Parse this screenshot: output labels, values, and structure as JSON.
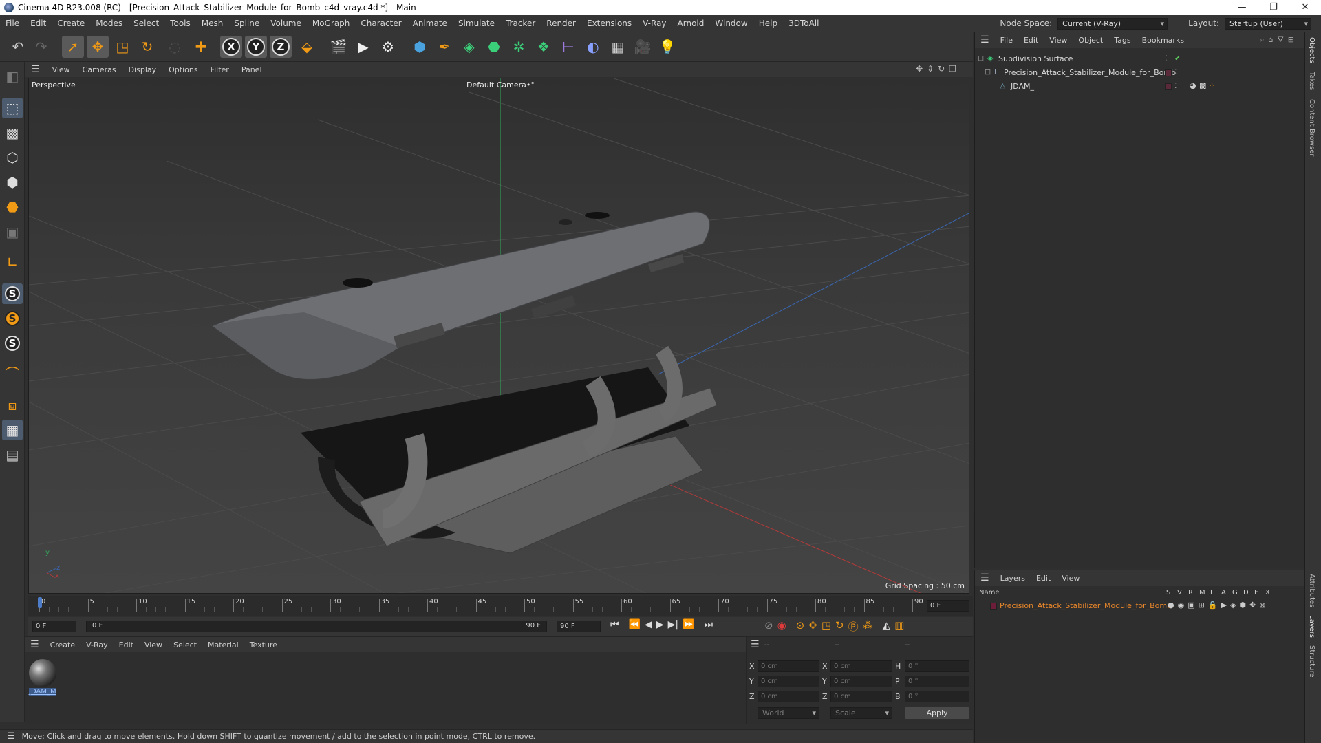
{
  "window": {
    "title": "Cinema 4D R23.008 (RC) - [Precision_Attack_Stabilizer_Module_for_Bomb_c4d_vray.c4d *] - Main",
    "controls": [
      "—",
      "❐",
      "✕"
    ]
  },
  "menubar": {
    "items": [
      "File",
      "Edit",
      "Create",
      "Modes",
      "Select",
      "Tools",
      "Mesh",
      "Spline",
      "Volume",
      "MoGraph",
      "Character",
      "Animate",
      "Simulate",
      "Tracker",
      "Render",
      "Extensions",
      "V-Ray",
      "Arnold",
      "Window",
      "Help",
      "3DToAll"
    ],
    "node_space_label": "Node Space:",
    "node_space_value": "Current (V-Ray)",
    "layout_label": "Layout:",
    "layout_value": "Startup (User)"
  },
  "toolbar": {
    "axis_x": "X",
    "axis_y": "Y",
    "axis_z": "Z",
    "icons": [
      "undo-icon",
      "redo-icon",
      "select-icon",
      "move-icon",
      "scale-icon",
      "rotate-icon",
      "live-select-icon",
      "add-icon",
      "x-axis-icon",
      "y-axis-icon",
      "z-axis-icon",
      "world-coord-icon",
      "render-region-icon",
      "render-view-icon",
      "render-settings-icon",
      "cube-icon",
      "pen-icon",
      "subdivision-icon",
      "extrude-icon",
      "cloner-icon",
      "polygon-icon",
      "spline-deformer-icon",
      "field-icon",
      "floor-icon",
      "camera-icon",
      "light-icon"
    ]
  },
  "viewport": {
    "menu": [
      "View",
      "Cameras",
      "Display",
      "Options",
      "Filter",
      "Panel"
    ],
    "label": "Perspective",
    "camera": "Default Camera",
    "camera_suffix": "•°",
    "grid_spacing": "Grid Spacing : 50 cm",
    "axis_y": "y",
    "axis_z": "z",
    "axis_x": "x"
  },
  "timeline": {
    "ticks": [
      "0",
      "5",
      "10",
      "15",
      "20",
      "25",
      "30",
      "35",
      "40",
      "45",
      "50",
      "55",
      "60",
      "65",
      "70",
      "75",
      "80",
      "85",
      "90"
    ],
    "current_frame": "0 F"
  },
  "transport": {
    "start": "0 F",
    "range_start": "0 F",
    "range_end": "90 F",
    "end": "90 F"
  },
  "material_manager": {
    "menu": [
      "Create",
      "V-Ray",
      "Edit",
      "View",
      "Select",
      "Material",
      "Texture"
    ],
    "materials": [
      {
        "name": "JDAM_M"
      }
    ]
  },
  "coordinates": {
    "headers": [
      "--",
      "--",
      "--"
    ],
    "rows": [
      {
        "a_label": "X",
        "a_val": "0 cm",
        "b_label": "X",
        "b_val": "0 cm",
        "c_label": "H",
        "c_val": "0 °"
      },
      {
        "a_label": "Y",
        "a_val": "0 cm",
        "b_label": "Y",
        "b_val": "0 cm",
        "c_label": "P",
        "c_val": "0 °"
      },
      {
        "a_label": "Z",
        "a_val": "0 cm",
        "b_label": "Z",
        "b_val": "0 cm",
        "c_label": "B",
        "c_val": "0 °"
      }
    ],
    "mode": "World",
    "transform": "Scale",
    "apply": "Apply"
  },
  "statusbar": {
    "text": "Move: Click and drag to move elements. Hold down SHIFT to quantize movement / add to the selection in point mode, CTRL to remove."
  },
  "objects_panel": {
    "menu": [
      "File",
      "Edit",
      "View",
      "Object",
      "Tags",
      "Bookmarks"
    ],
    "items": [
      {
        "name": "Subdivision Surface"
      },
      {
        "name": "Precision_Attack_Stabilizer_Module_for_Bomb"
      },
      {
        "name": "JDAM_"
      }
    ]
  },
  "layers_panel": {
    "menu": [
      "Layers",
      "Edit",
      "View"
    ],
    "name_header": "Name",
    "columns": [
      "S",
      "V",
      "R",
      "M",
      "L",
      "A",
      "G",
      "D",
      "E",
      "X"
    ],
    "layers": [
      {
        "name": "Precision_Attack_Stabilizer_Module_for_Bomb",
        "color": "#6b1d3a"
      }
    ]
  },
  "side_tabs": [
    "Objects",
    "Takes",
    "Content Browser",
    "Attributes",
    "Layers",
    "Structure"
  ],
  "colors": {
    "accent_orange": "#f19a16",
    "layer_text": "#e8862a",
    "selected_blue": "#4d5b6e"
  }
}
